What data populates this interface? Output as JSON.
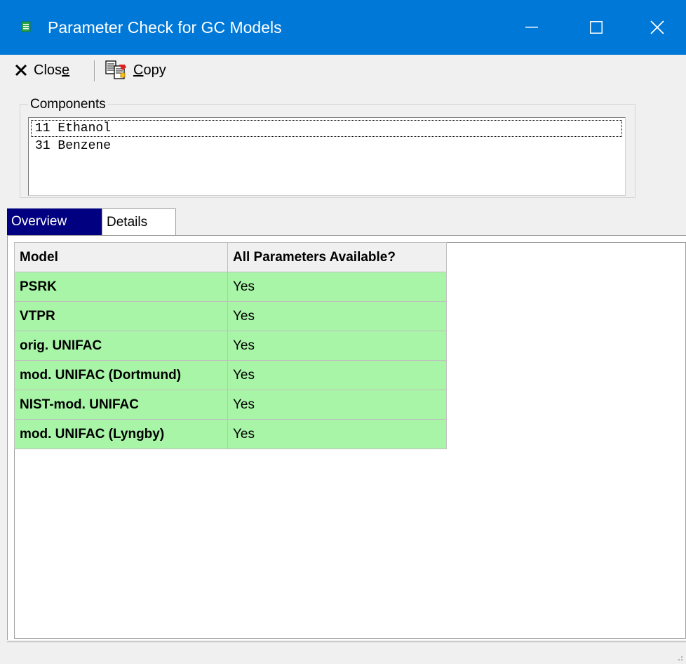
{
  "window": {
    "title": "Parameter Check for GC Models",
    "accent_color": "#0078d7"
  },
  "toolbar": {
    "close_prefix": "Clos",
    "close_mnemonic": "e",
    "copy_mnemonic": "C",
    "copy_rest": "opy"
  },
  "components": {
    "group_label": "Components",
    "items": [
      {
        "text": "11 Ethanol"
      },
      {
        "text": "31 Benzene"
      }
    ]
  },
  "tabs": [
    {
      "label": "Overview",
      "selected": true
    },
    {
      "label": "Details",
      "selected": false
    }
  ],
  "grid": {
    "headers": [
      "Model",
      "All Parameters Available?"
    ],
    "row_color": "#a8f5a8",
    "rows": [
      {
        "model": "PSRK",
        "available": "Yes"
      },
      {
        "model": "VTPR",
        "available": "Yes"
      },
      {
        "model": "orig. UNIFAC",
        "available": "Yes"
      },
      {
        "model": "mod. UNIFAC (Dortmund)",
        "available": "Yes"
      },
      {
        "model": "NIST-mod. UNIFAC",
        "available": "Yes"
      },
      {
        "model": "mod. UNIFAC (Lyngby)",
        "available": "Yes"
      }
    ]
  }
}
